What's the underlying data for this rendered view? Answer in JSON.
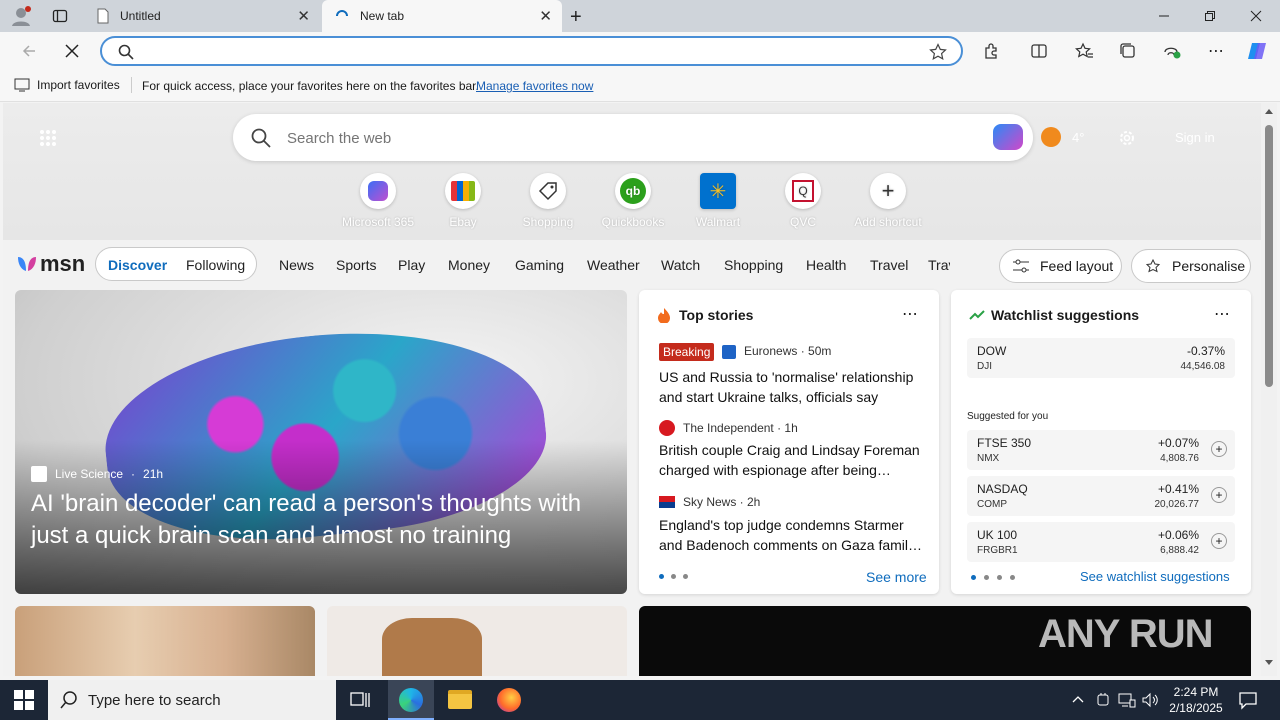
{
  "browser": {
    "tabs": [
      {
        "title": "Untitled",
        "active": false
      },
      {
        "title": "New tab",
        "active": true
      }
    ],
    "address": {
      "value": "",
      "placeholder": ""
    }
  },
  "favorites_bar": {
    "import_label": "Import favorites",
    "message": "For quick access, place your favorites here on the favorites bar.",
    "manage_link": "Manage favorites now"
  },
  "newtab": {
    "search_placeholder": "Search the web",
    "weather_temp": "4°",
    "signin_label": "Sign in",
    "shortcuts": [
      {
        "label": "Microsoft 365",
        "icon": "m365-icon"
      },
      {
        "label": "Ebay",
        "icon": "ebay-icon"
      },
      {
        "label": "Shopping",
        "icon": "shopping-tag-icon"
      },
      {
        "label": "Quickbooks",
        "icon": "quickbooks-icon"
      },
      {
        "label": "Walmart",
        "icon": "walmart-icon"
      },
      {
        "label": "QVC",
        "icon": "qvc-icon"
      },
      {
        "label": "Add shortcut",
        "icon": "plus-icon"
      }
    ]
  },
  "msn": {
    "logo_text": "msn",
    "toggle": {
      "discover": "Discover",
      "following": "Following"
    },
    "nav": [
      "News",
      "Sports",
      "Play",
      "Money",
      "Gaming",
      "Weather",
      "Watch",
      "Shopping",
      "Health",
      "Travel",
      "Trav"
    ],
    "feed_layout": "Feed layout",
    "personalise": "Personalise"
  },
  "hero_story": {
    "source": "Live Science",
    "age": "21h",
    "headline": "AI 'brain decoder' can read a person's thoughts with just a quick brain scan and almost no training"
  },
  "top_stories": {
    "title": "Top stories",
    "items": [
      {
        "badge": "Breaking",
        "source": "Euronews · 50m",
        "headline": "US and Russia to 'normalise' relationship and start Ukraine talks, officials say"
      },
      {
        "badge": "",
        "source": "The Independent · 1h",
        "headline": "British couple Craig and Lindsay Foreman charged with espionage after being…"
      },
      {
        "badge": "",
        "source": "Sky News · 2h",
        "headline": "England's top judge condemns Starmer and Badenoch comments on Gaza famil…"
      }
    ],
    "see_more": "See more"
  },
  "watchlist": {
    "title": "Watchlist suggestions",
    "primary": {
      "symbol": "DOW",
      "sub": "DJI",
      "change": "-0.37%",
      "value": "44,546.08"
    },
    "suggested_label": "Suggested for you",
    "items": [
      {
        "symbol": "FTSE 350",
        "sub": "NMX",
        "change": "+0.07%",
        "value": "4,808.76"
      },
      {
        "symbol": "NASDAQ",
        "sub": "COMP",
        "change": "+0.41%",
        "value": "20,026.77"
      },
      {
        "symbol": "UK 100",
        "sub": "FRGBR1",
        "change": "+0.06%",
        "value": "6,888.42"
      }
    ],
    "see_link": "See watchlist suggestions"
  },
  "watermark": "ANY RUN",
  "taskbar": {
    "search_placeholder": "Type here to search",
    "time": "2:24 PM",
    "date": "2/18/2025"
  },
  "colors": {
    "accent": "#0f6cbd",
    "breaking": "#c42b1c",
    "taskbar": "#1c2636"
  }
}
